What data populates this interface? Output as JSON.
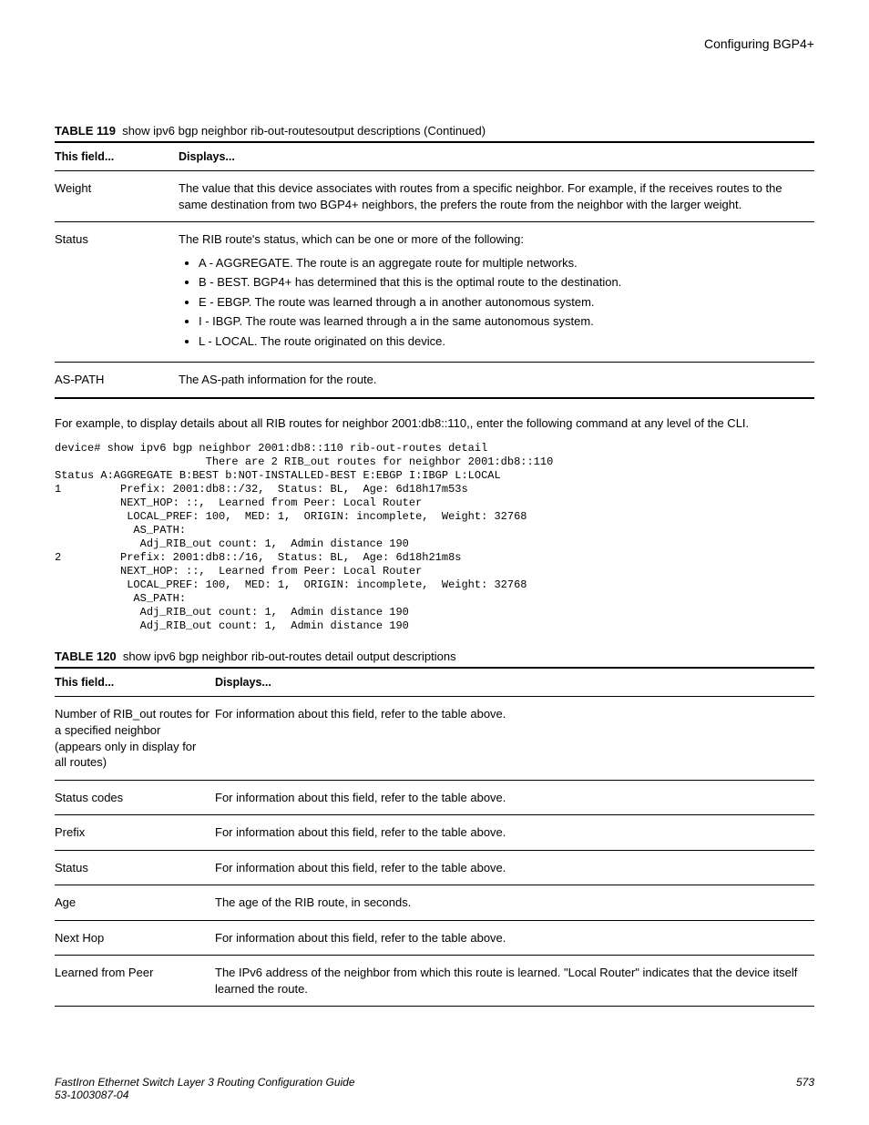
{
  "header": {
    "running": "Configuring BGP4+"
  },
  "table119": {
    "caption_label": "TABLE 119",
    "caption_text": "show ipv6 bgp neighbor rib-out-routesoutput descriptions (Continued)",
    "head_field": "This field...",
    "head_disp": "Displays...",
    "rows": [
      {
        "field": "Weight",
        "disp": "The value that this device associates with routes from a specific neighbor. For example, if the receives routes to the same destination from two BGP4+ neighbors, the prefers the route from the neighbor with the larger weight."
      },
      {
        "field": "Status",
        "disp_intro": "The RIB route's status, which can be one or more of the following:",
        "bullets": [
          "A - AGGREGATE. The route is an aggregate route for multiple networks.",
          "B - BEST. BGP4+ has determined that this is the optimal route to the destination.",
          "E - EBGP. The route was learned through a in another autonomous system.",
          "I - IBGP. The route was learned through a in the same autonomous system.",
          "L - LOCAL. The route originated on this device."
        ]
      },
      {
        "field": "AS-PATH",
        "disp": "The AS-path information for the route."
      }
    ]
  },
  "mid_para": "For example, to display details about all RIB routes for neighbor 2001:db8::110,, enter the following command at any level of the CLI.",
  "cli": "device# show ipv6 bgp neighbor 2001:db8::110 rib-out-routes detail\n                       There are 2 RIB_out routes for neighbor 2001:db8::110\nStatus A:AGGREGATE B:BEST b:NOT-INSTALLED-BEST E:EBGP I:IBGP L:LOCAL\n1         Prefix: 2001:db8::/32,  Status: BL,  Age: 6d18h17m53s\n          NEXT_HOP: ::,  Learned from Peer: Local Router\n           LOCAL_PREF: 100,  MED: 1,  ORIGIN: incomplete,  Weight: 32768\n            AS_PATH:\n             Adj_RIB_out count: 1,  Admin distance 190\n2         Prefix: 2001:db8::/16,  Status: BL,  Age: 6d18h21m8s\n          NEXT_HOP: ::,  Learned from Peer: Local Router\n           LOCAL_PREF: 100,  MED: 1,  ORIGIN: incomplete,  Weight: 32768\n            AS_PATH:\n             Adj_RIB_out count: 1,  Admin distance 190\n             Adj_RIB_out count: 1,  Admin distance 190",
  "table120": {
    "caption_label": "TABLE 120",
    "caption_text": "show ipv6 bgp neighbor rib-out-routes detail output descriptions",
    "head_field": "This field...",
    "head_disp": "Displays...",
    "rows": [
      {
        "field": "Number of RIB_out routes for a specified neighbor (appears only in display for all routes)",
        "disp": "For information about this field, refer to the table above."
      },
      {
        "field": "Status codes",
        "disp": "For information about this field, refer to the table above."
      },
      {
        "field": "Prefix",
        "disp": "For information about this field, refer to the table above."
      },
      {
        "field": "Status",
        "disp": "For information about this field, refer to the table above."
      },
      {
        "field": "Age",
        "disp": "The age of the RIB route, in seconds."
      },
      {
        "field": "Next Hop",
        "disp": "For information about this field, refer to the table above."
      },
      {
        "field": "Learned from Peer",
        "disp": "The IPv6 address of the neighbor from which this route is learned. \"Local Router\" indicates that the device itself learned the route."
      }
    ]
  },
  "footer": {
    "title": "FastIron Ethernet Switch Layer 3 Routing Configuration Guide",
    "docnum": "53-1003087-04",
    "page": "573"
  }
}
